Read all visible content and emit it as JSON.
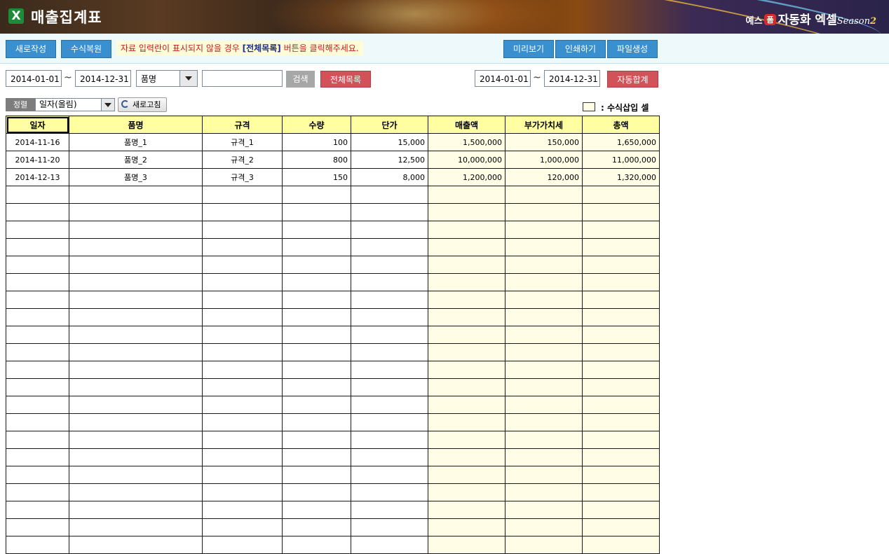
{
  "header": {
    "logo": "X",
    "title": "매출집계표",
    "brand": {
      "prefix": "예스",
      "badge": "폼",
      "name": "자동화 엑셀",
      "season_word": "Season",
      "season_num": "2"
    }
  },
  "toolbar": {
    "new_label": "새로작성",
    "restore_label": "수식복원",
    "notice_pre": "자료 입력란이 표시되지  않을 경우",
    "notice_bold": "[전체목록]",
    "notice_post": "버튼을 클릭해주세요.",
    "preview_label": "미리보기",
    "print_label": "인쇄하기",
    "file_label": "파일생성"
  },
  "filter": {
    "date_from": "2014-01-01",
    "tilde": "~",
    "date_to": "2014-12-31",
    "field_select": "품명",
    "keyword": "",
    "search_label": "검색",
    "all_list_label": "전체목록",
    "sum_date_from": "2014-01-01",
    "sum_date_to": "2014-12-31",
    "auto_sum_label": "자동합계"
  },
  "sort": {
    "label": "정렬",
    "value": "일자(올림)",
    "refresh_label": "새로고침"
  },
  "legend": {
    "label": ": 수식삽입 셀"
  },
  "table": {
    "headers": [
      "일자",
      "품명",
      "규격",
      "수량",
      "단가",
      "매출액",
      "부가가치세",
      "총액"
    ],
    "rows": [
      [
        "2014-11-16",
        "품명_1",
        "규격_1",
        "100",
        "15,000",
        "1,500,000",
        "150,000",
        "1,650,000"
      ],
      [
        "2014-11-20",
        "품명_2",
        "규격_2",
        "800",
        "12,500",
        "10,000,000",
        "1,000,000",
        "11,000,000"
      ],
      [
        "2014-12-13",
        "품명_3",
        "규격_3",
        "150",
        "8,000",
        "1,200,000",
        "120,000",
        "1,320,000"
      ]
    ],
    "empty_rows": 21
  },
  "colors": {
    "header_yellow": "#fffea0",
    "formula_cell": "#fffde6",
    "button_blue": "#3a8fcf",
    "button_red": "#d2525a",
    "notice_red": "#c01f1f"
  }
}
